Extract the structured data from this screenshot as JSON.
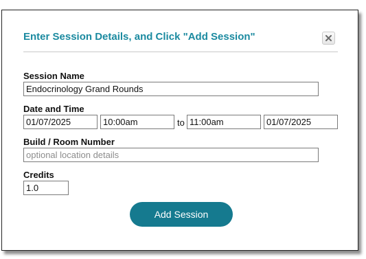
{
  "dialog": {
    "title": "Enter Session Details, and Click \"Add Session\"",
    "close_icon": "close-x-icon"
  },
  "session_name": {
    "label": "Session Name",
    "value": "Endocrinology Grand Rounds"
  },
  "date_time": {
    "label": "Date and Time",
    "start_date": "01/07/2025",
    "start_time": "10:00am",
    "separator": "to",
    "end_time": "11:00am",
    "end_date": "01/07/2025"
  },
  "location": {
    "label": "Build / Room Number",
    "value": "",
    "placeholder": "optional location details"
  },
  "credits": {
    "label": "Credits",
    "value": "1.0"
  },
  "actions": {
    "add_session_label": "Add Session"
  },
  "colors": {
    "title_accent": "#1b8aa0",
    "button_background": "#157a8f",
    "button_text": "#ffffff"
  }
}
